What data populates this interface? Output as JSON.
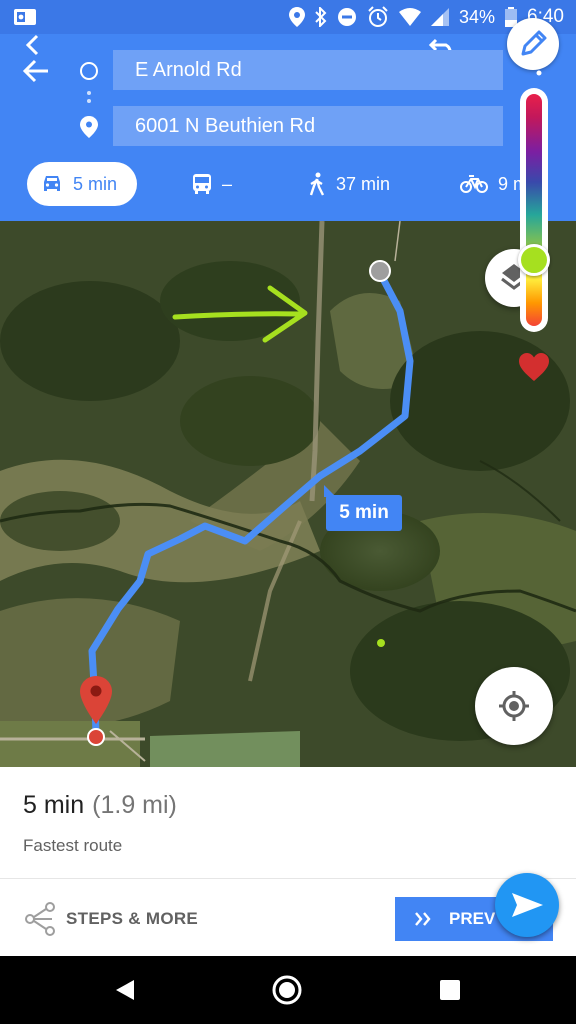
{
  "status_bar": {
    "battery": "34%",
    "time": "6:40",
    "icons": [
      "outlook-icon",
      "location-icon",
      "bluetooth-icon",
      "do-not-disturb-icon",
      "alarm-icon",
      "wifi-icon",
      "cell-signal-icon",
      "battery-icon"
    ]
  },
  "header": {
    "origin": "E Arnold Rd",
    "destination": "6001 N Beuthien Rd",
    "modes": {
      "drive": "5 min",
      "transit": "–",
      "walk": "37 min",
      "bike": "9 m"
    }
  },
  "map": {
    "route_eta": "5 min"
  },
  "route": {
    "duration": "5 min",
    "distance": "(1.9 mi)",
    "description": "Fastest route"
  },
  "actions": {
    "steps": "STEPS & MORE",
    "preview": "PREV"
  },
  "colors": {
    "brand_blue": "#4285f4",
    "status_blue": "#3b78e7",
    "route_blue": "#4b8ef5",
    "annotation_green": "#a6e01f",
    "pin_red": "#db4437"
  }
}
